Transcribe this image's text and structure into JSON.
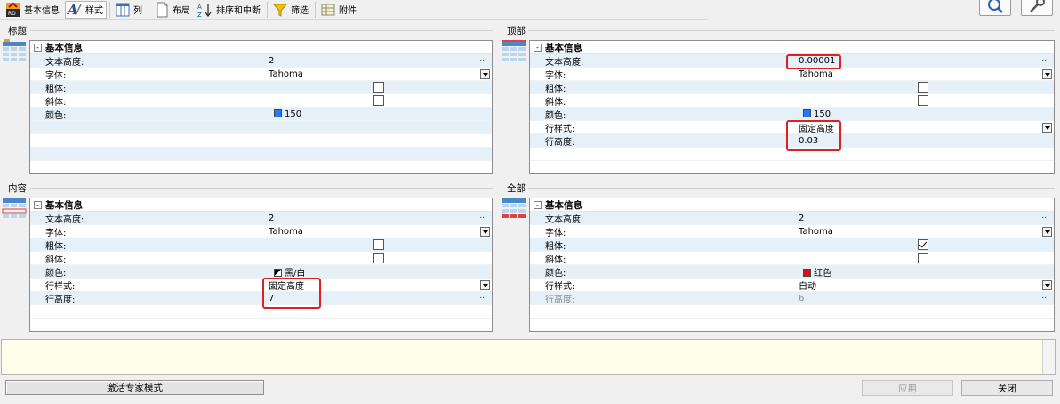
{
  "toolbar": {
    "tabs": [
      {
        "label": "基本信息",
        "icon": "app-logo-icon"
      },
      {
        "label": "样式",
        "icon": "style-icon"
      },
      {
        "label": "列",
        "icon": "columns-icon"
      },
      {
        "label": "布局",
        "icon": "layout-icon"
      },
      {
        "label": "排序和中断",
        "icon": "sort-icon"
      },
      {
        "label": "筛选",
        "icon": "filter-icon"
      },
      {
        "label": "附件",
        "icon": "attachment-icon"
      }
    ],
    "active_tab": "样式"
  },
  "panels": {
    "title": {
      "label": "标题",
      "group": "基本信息",
      "rows": {
        "text_height": {
          "label": "文本高度:",
          "value": "2"
        },
        "font": {
          "label": "字体:",
          "value": "Tahoma"
        },
        "bold": {
          "label": "粗体:"
        },
        "italic": {
          "label": "斜体:"
        },
        "color": {
          "label": "颜色:",
          "value": "150",
          "swatch": "#1e7bff"
        }
      }
    },
    "top": {
      "label": "顶部",
      "group": "基本信息",
      "rows": {
        "text_height": {
          "label": "文本高度:",
          "value": "0.00001"
        },
        "font": {
          "label": "字体:",
          "value": "Tahoma"
        },
        "bold": {
          "label": "粗体:"
        },
        "italic": {
          "label": "斜体:"
        },
        "color": {
          "label": "颜色:",
          "value": "150",
          "swatch": "#1e7bff"
        },
        "row_style": {
          "label": "行样式:",
          "value": "固定高度"
        },
        "row_height": {
          "label": "行高度:",
          "value": "0.03"
        }
      }
    },
    "content": {
      "label": "内容",
      "group": "基本信息",
      "rows": {
        "text_height": {
          "label": "文本高度:",
          "value": "2"
        },
        "font": {
          "label": "字体:",
          "value": "Tahoma"
        },
        "bold": {
          "label": "粗体:"
        },
        "italic": {
          "label": "斜体:"
        },
        "color": {
          "label": "颜色:",
          "value": "黑/白"
        },
        "row_style": {
          "label": "行样式:",
          "value": "固定高度"
        },
        "row_height": {
          "label": "行高度:",
          "value": "7"
        }
      }
    },
    "all": {
      "label": "全部",
      "group": "基本信息",
      "rows": {
        "text_height": {
          "label": "文本高度:",
          "value": "2"
        },
        "font": {
          "label": "字体:",
          "value": "Tahoma"
        },
        "bold": {
          "label": "粗体:",
          "checked": true
        },
        "italic": {
          "label": "斜体:"
        },
        "color": {
          "label": "颜色:",
          "value": "红色",
          "swatch": "#e01010"
        },
        "row_style": {
          "label": "行样式:",
          "value": "自动"
        },
        "row_height": {
          "label": "行高度:",
          "value": "6"
        }
      }
    }
  },
  "footer": {
    "expert_mode_label": "激活专家模式",
    "apply_label": "应用",
    "close_label": "关闭"
  },
  "dots": "..."
}
